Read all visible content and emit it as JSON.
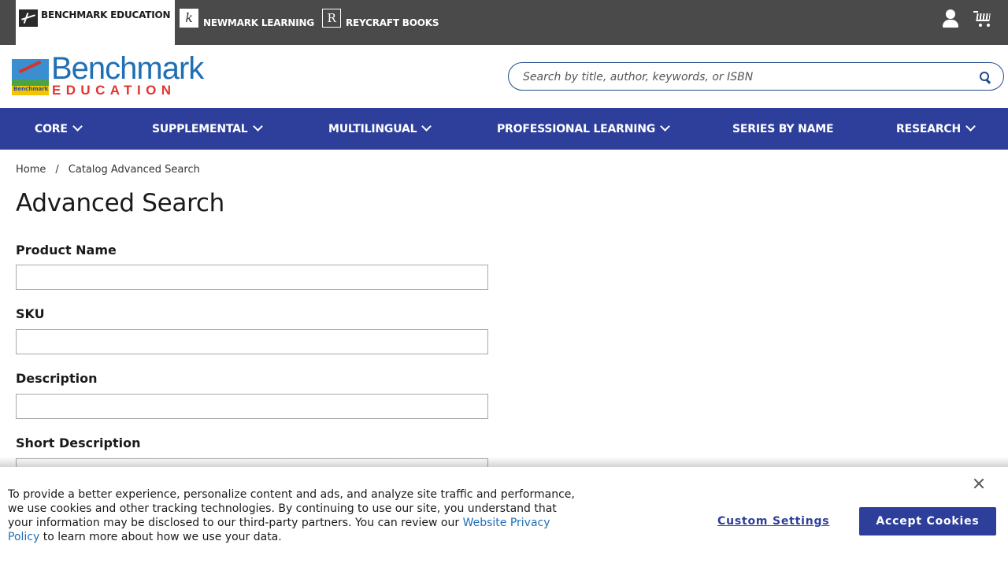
{
  "topbar": {
    "brands": [
      {
        "label": "BENCHMARK EDUCATION",
        "active": true
      },
      {
        "label": "NEWMARK LEARNING",
        "icon_glyph": "k"
      },
      {
        "label": "REYCRAFT BOOKS",
        "icon_glyph": "R"
      }
    ],
    "icons": [
      "user-account-icon",
      "shopping-cart-icon"
    ]
  },
  "logo": {
    "line1": "Benchmark",
    "line2": "EDUCATION",
    "mini": "Benchmark"
  },
  "search": {
    "placeholder": "Search by title, author, keywords, or ISBN",
    "value": ""
  },
  "mainnav": {
    "items": [
      {
        "label": "CORE",
        "dropdown": true
      },
      {
        "label": "SUPPLEMENTAL",
        "dropdown": true
      },
      {
        "label": "MULTILINGUAL",
        "dropdown": true
      },
      {
        "label": "PROFESSIONAL LEARNING",
        "dropdown": true
      },
      {
        "label": "SERIES BY NAME",
        "dropdown": false
      },
      {
        "label": "RESEARCH",
        "dropdown": true
      }
    ]
  },
  "breadcrumb": {
    "home": "Home",
    "separator": "/",
    "current": "Catalog Advanced Search"
  },
  "page": {
    "title": "Advanced Search"
  },
  "form": {
    "fields": [
      {
        "label": "Product Name",
        "value": ""
      },
      {
        "label": "SKU",
        "value": ""
      },
      {
        "label": "Description",
        "value": ""
      },
      {
        "label": "Short Description",
        "value": ""
      }
    ]
  },
  "cookie": {
    "text_before": "To provide a better experience, personalize content and ads, and analyze site traffic and performance, we use cookies and other tracking technologies. By continuing to use our site, you understand that your information may be disclosed to our third-party partners. You can review our ",
    "link": "Website Privacy Policy",
    "text_after": " to learn more about how we use your data.",
    "custom_label": "Custom Settings",
    "accept_label": "Accept Cookies"
  },
  "colors": {
    "topbar": "#4a4a4a",
    "nav": "#2d3f9a",
    "accent_blue": "#1f6fb5",
    "accent_red": "#e3342f"
  }
}
